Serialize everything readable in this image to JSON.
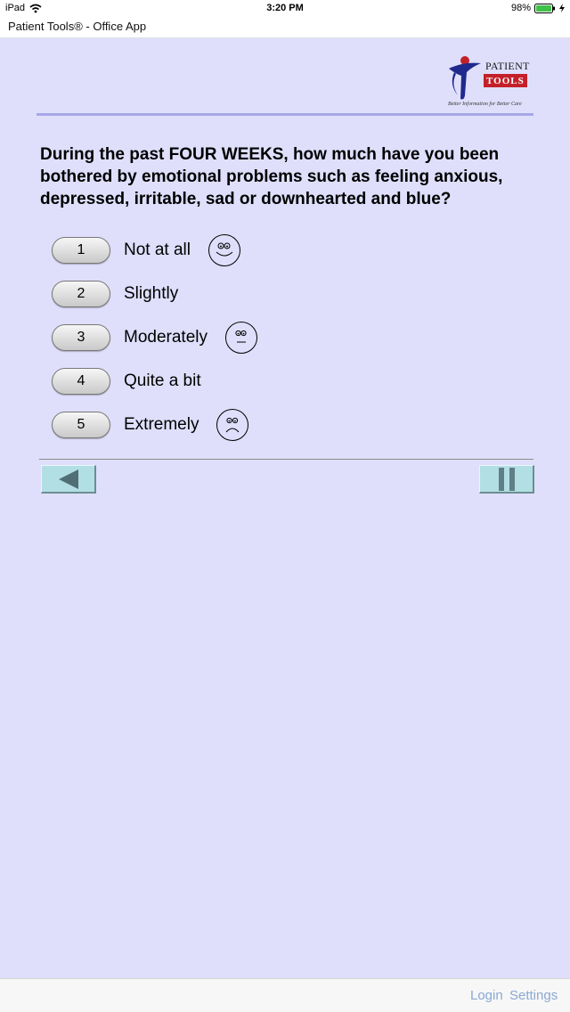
{
  "status_bar": {
    "device": "iPad",
    "time": "3:20 PM",
    "battery": "98%"
  },
  "app": {
    "title": "Patient Tools® - Office App"
  },
  "logo": {
    "line1": "PATIENT",
    "line2": "TOOLS",
    "tagline": "Better Information for Better Care"
  },
  "question": {
    "text": "During the past FOUR WEEKS, how much have you been bothered by emotional problems such as feeling anxious, depressed, irritable, sad or downhearted and blue?"
  },
  "options": [
    {
      "number": "1",
      "label": "Not at all",
      "icon": "smiley-face-icon"
    },
    {
      "number": "2",
      "label": "Slightly",
      "icon": ""
    },
    {
      "number": "3",
      "label": "Moderately",
      "icon": "neutral-face-icon"
    },
    {
      "number": "4",
      "label": "Quite a bit",
      "icon": ""
    },
    {
      "number": "5",
      "label": "Extremely",
      "icon": "frowning-face-icon"
    }
  ],
  "navigation": {
    "back_icon": "back-arrow-icon",
    "pause_icon": "pause-icon"
  },
  "toolbar": {
    "login": "Login",
    "settings": "Settings"
  },
  "colors": {
    "background": "#dfdffc",
    "rule": "#a7a7e6",
    "nav_button": "#b2dfe4",
    "toolbar_link": "#8aa9d4",
    "logo_red": "#c4202a",
    "logo_blue": "#1f2a8c"
  }
}
